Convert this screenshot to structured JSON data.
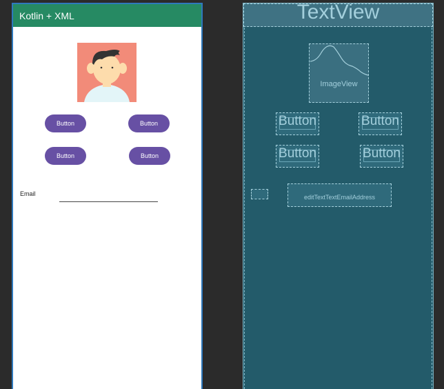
{
  "preview": {
    "app_title": "Kotlin + XML",
    "buttons": [
      "Button",
      "Button",
      "Button",
      "Button"
    ],
    "email_label": "Email",
    "colors": {
      "appbar": "#268a63",
      "button": "#6750a4",
      "avatar_bg": "#f28b79"
    }
  },
  "blueprint": {
    "title_view": "TextView",
    "image_view": "ImageView",
    "buttons": [
      "Button",
      "Button",
      "Button",
      "Button"
    ],
    "email_field": "editTextTextEmailAddress",
    "colors": {
      "background": "#235b6a",
      "outline": "#a7d2de"
    }
  }
}
